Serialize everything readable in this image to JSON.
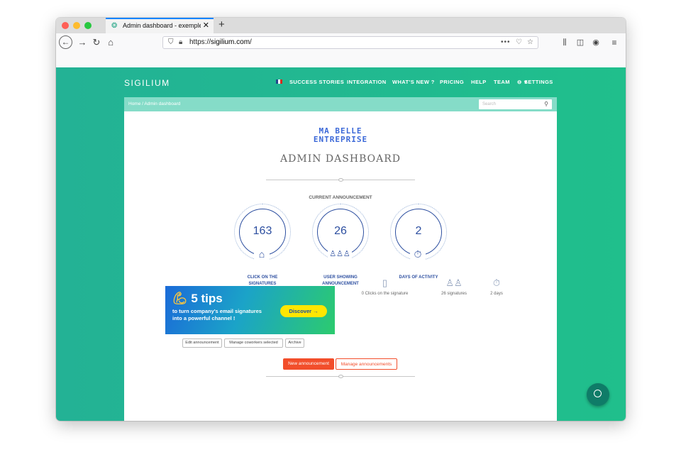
{
  "browser": {
    "tab_title": "Admin dashboard - exemple@",
    "tab_close": "✕",
    "new_tab": "+",
    "url_prefix": "https://",
    "url_host": "sigilium.com",
    "url_suffix": "/",
    "colors": {
      "close": "#ff5f57",
      "minimize": "#febc2e",
      "zoom": "#28c840"
    }
  },
  "site": {
    "brand": "SIGILIUM",
    "nav": [
      "SUCCESS STORIES",
      "INTEGRATION",
      "WHAT'S NEW ?",
      "PRICING",
      "HELP",
      "TEAM",
      "SETTINGS"
    ],
    "breadcrumb": "Home  /  Admin dashboard",
    "search_placeholder": "Search"
  },
  "dashboard": {
    "logo_line1": "MA BELLE",
    "logo_line2": "ENTREPRISE",
    "title": "ADMIN DASHBOARD",
    "current_announcement": "CURRENT ANNOUNCEMENT",
    "stats": [
      {
        "value": "163",
        "label": "CLICK ON THE SIGNATURES",
        "icon": "mouse-icon"
      },
      {
        "value": "26",
        "label": "USER SHOWING ANNOUNCEMENT",
        "icon": "users-icon"
      },
      {
        "value": "2",
        "label": "DAYS OF ACTIVITY",
        "icon": "stopwatch-icon"
      }
    ],
    "banner": {
      "tips": "5 tips",
      "line1": "to turn company's email signatures",
      "line2": "into a powerful channel !",
      "discover": "Discover →"
    },
    "actions": [
      "Edit announcement",
      "Manage coworkers selected",
      "Archive"
    ],
    "mini": [
      {
        "text": "0 Clicks on the signature",
        "icon": "mouse-icon"
      },
      {
        "text": "26 signatures",
        "icon": "users-icon"
      },
      {
        "text": "2 days",
        "icon": "stopwatch-icon"
      }
    ],
    "new_announcement": "New announcement",
    "manage_announcements": "Manage announcements",
    "accent": "#f24e2b"
  }
}
